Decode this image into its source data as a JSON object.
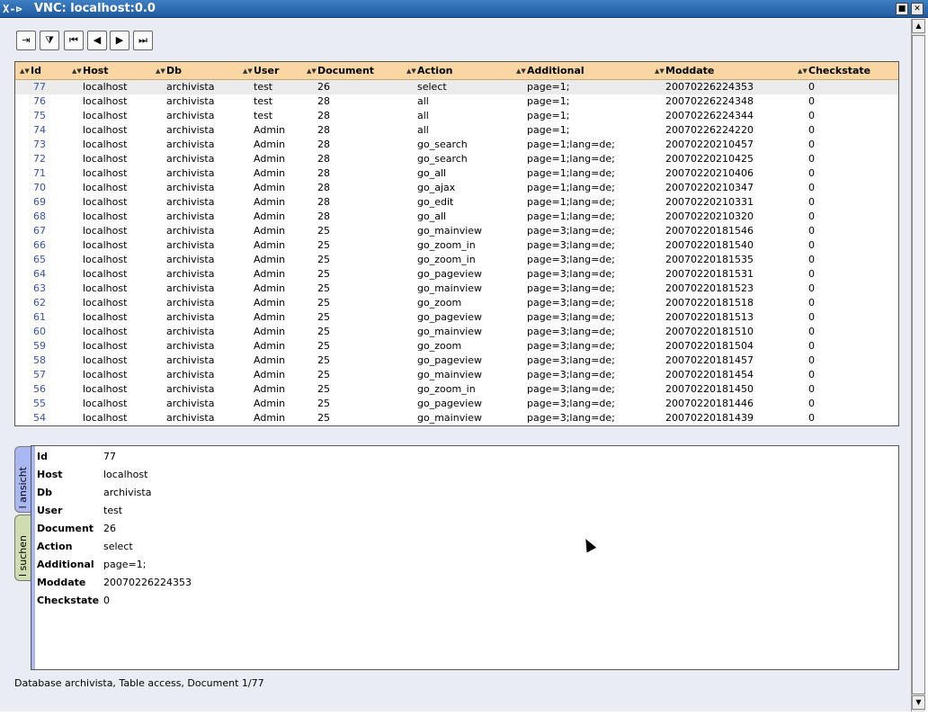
{
  "window": {
    "title": "VNC: localhost:0.0",
    "logo": "X-⊳",
    "restore_glyph": "■",
    "close_glyph": "✕"
  },
  "toolbar": {
    "buttons": [
      {
        "name": "exit-icon",
        "glyph": "⇥"
      },
      {
        "name": "filter-icon",
        "glyph": "⧩"
      },
      {
        "name": "first-record-icon",
        "glyph": "⏮"
      },
      {
        "name": "prev-record-icon",
        "glyph": "◀"
      },
      {
        "name": "next-record-icon",
        "glyph": "▶"
      },
      {
        "name": "last-record-icon",
        "glyph": "⏭"
      }
    ]
  },
  "table": {
    "columns": [
      "Id",
      "Host",
      "Db",
      "User",
      "Document",
      "Action",
      "Additional",
      "Moddate",
      "Checkstate"
    ],
    "rows": [
      [
        "77",
        "localhost",
        "archivista",
        "test",
        "26",
        "select",
        "page=1;",
        "20070226224353",
        "0"
      ],
      [
        "76",
        "localhost",
        "archivista",
        "test",
        "28",
        "all",
        "page=1;",
        "20070226224348",
        "0"
      ],
      [
        "75",
        "localhost",
        "archivista",
        "test",
        "28",
        "all",
        "page=1;",
        "20070226224344",
        "0"
      ],
      [
        "74",
        "localhost",
        "archivista",
        "Admin",
        "28",
        "all",
        "page=1;",
        "20070226224220",
        "0"
      ],
      [
        "73",
        "localhost",
        "archivista",
        "Admin",
        "28",
        "go_search",
        "page=1;lang=de;",
        "20070220210457",
        "0"
      ],
      [
        "72",
        "localhost",
        "archivista",
        "Admin",
        "28",
        "go_search",
        "page=1;lang=de;",
        "20070220210425",
        "0"
      ],
      [
        "71",
        "localhost",
        "archivista",
        "Admin",
        "28",
        "go_all",
        "page=1;lang=de;",
        "20070220210406",
        "0"
      ],
      [
        "70",
        "localhost",
        "archivista",
        "Admin",
        "28",
        "go_ajax",
        "page=1;lang=de;",
        "20070220210347",
        "0"
      ],
      [
        "69",
        "localhost",
        "archivista",
        "Admin",
        "28",
        "go_edit",
        "page=1;lang=de;",
        "20070220210331",
        "0"
      ],
      [
        "68",
        "localhost",
        "archivista",
        "Admin",
        "28",
        "go_all",
        "page=1;lang=de;",
        "20070220210320",
        "0"
      ],
      [
        "67",
        "localhost",
        "archivista",
        "Admin",
        "25",
        "go_mainview",
        "page=3;lang=de;",
        "20070220181546",
        "0"
      ],
      [
        "66",
        "localhost",
        "archivista",
        "Admin",
        "25",
        "go_zoom_in",
        "page=3;lang=de;",
        "20070220181540",
        "0"
      ],
      [
        "65",
        "localhost",
        "archivista",
        "Admin",
        "25",
        "go_zoom_in",
        "page=3;lang=de;",
        "20070220181535",
        "0"
      ],
      [
        "64",
        "localhost",
        "archivista",
        "Admin",
        "25",
        "go_pageview",
        "page=3;lang=de;",
        "20070220181531",
        "0"
      ],
      [
        "63",
        "localhost",
        "archivista",
        "Admin",
        "25",
        "go_mainview",
        "page=3;lang=de;",
        "20070220181523",
        "0"
      ],
      [
        "62",
        "localhost",
        "archivista",
        "Admin",
        "25",
        "go_zoom",
        "page=3;lang=de;",
        "20070220181518",
        "0"
      ],
      [
        "61",
        "localhost",
        "archivista",
        "Admin",
        "25",
        "go_pageview",
        "page=3;lang=de;",
        "20070220181513",
        "0"
      ],
      [
        "60",
        "localhost",
        "archivista",
        "Admin",
        "25",
        "go_mainview",
        "page=3;lang=de;",
        "20070220181510",
        "0"
      ],
      [
        "59",
        "localhost",
        "archivista",
        "Admin",
        "25",
        "go_zoom",
        "page=3;lang=de;",
        "20070220181504",
        "0"
      ],
      [
        "58",
        "localhost",
        "archivista",
        "Admin",
        "25",
        "go_pageview",
        "page=3;lang=de;",
        "20070220181457",
        "0"
      ],
      [
        "57",
        "localhost",
        "archivista",
        "Admin",
        "25",
        "go_mainview",
        "page=3;lang=de;",
        "20070220181454",
        "0"
      ],
      [
        "56",
        "localhost",
        "archivista",
        "Admin",
        "25",
        "go_zoom_in",
        "page=3;lang=de;",
        "20070220181450",
        "0"
      ],
      [
        "55",
        "localhost",
        "archivista",
        "Admin",
        "25",
        "go_pageview",
        "page=3;lang=de;",
        "20070220181446",
        "0"
      ],
      [
        "54",
        "localhost",
        "archivista",
        "Admin",
        "25",
        "go_mainview",
        "page=3;lang=de;",
        "20070220181439",
        "0"
      ]
    ]
  },
  "detail": {
    "fields": [
      {
        "label": "Id",
        "value": "77"
      },
      {
        "label": "Host",
        "value": "localhost"
      },
      {
        "label": "Db",
        "value": "archivista"
      },
      {
        "label": "User",
        "value": "test"
      },
      {
        "label": "Document",
        "value": "26"
      },
      {
        "label": "Action",
        "value": "select"
      },
      {
        "label": "Additional",
        "value": "page=1;"
      },
      {
        "label": "Moddate",
        "value": "20070226224353"
      },
      {
        "label": "Checkstate",
        "value": "0"
      }
    ],
    "tabs": [
      {
        "label": "l ansicht",
        "color": "#a9b7f2"
      },
      {
        "label": "l suchen",
        "color": "#cfdcb0"
      }
    ]
  },
  "status": "Database archivista, Table access, Document 1/77",
  "scrollbar": {
    "up_glyph": "▲",
    "down_glyph": "▼"
  },
  "colors": {
    "header": "#f9d6a2",
    "id_link": "#3753a8",
    "selected_row": "#ebebeb"
  }
}
